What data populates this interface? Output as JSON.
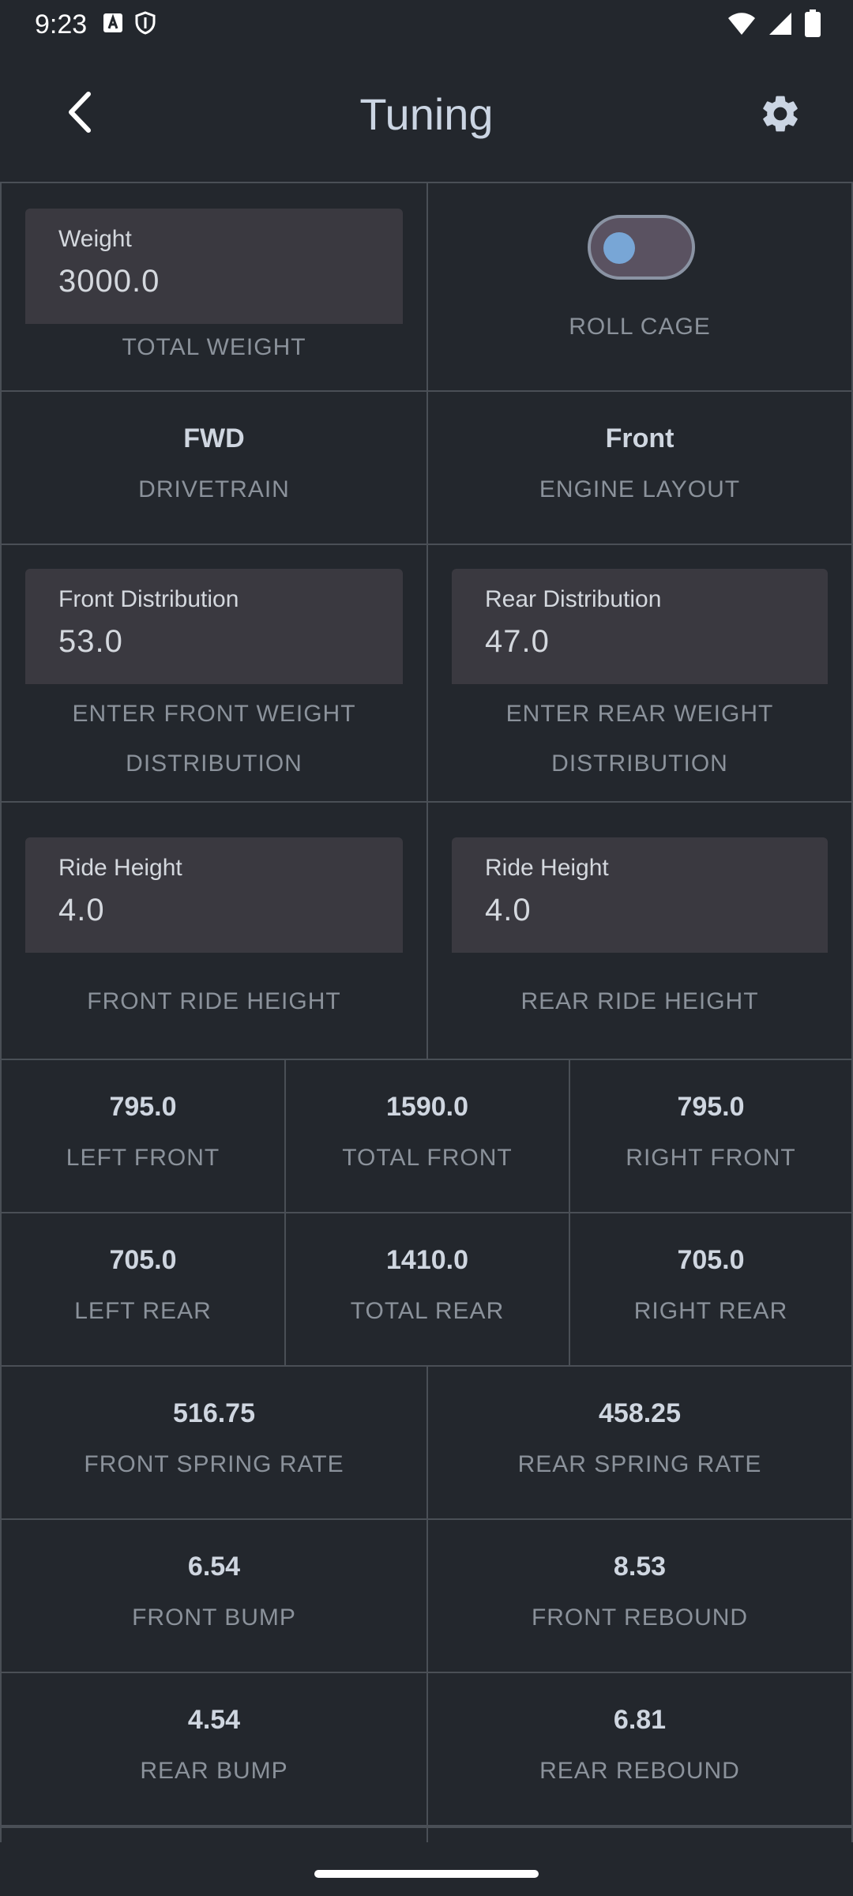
{
  "status_bar": {
    "time": "9:23"
  },
  "app_bar": {
    "title": "Tuning"
  },
  "weight_field": {
    "label": "Weight",
    "value": "3000.0",
    "caption": "TOTAL WEIGHT"
  },
  "roll_cage": {
    "caption": "ROLL CAGE",
    "enabled": false
  },
  "drivetrain": {
    "value": "FWD",
    "caption": "DRIVETRAIN"
  },
  "engine_layout": {
    "value": "Front",
    "caption": "ENGINE LAYOUT"
  },
  "front_distribution": {
    "label": "Front Distribution",
    "value": "53.0",
    "caption_line1": "ENTER FRONT WEIGHT",
    "caption_line2": "DISTRIBUTION"
  },
  "rear_distribution": {
    "label": "Rear Distribution",
    "value": "47.0",
    "caption_line1": "ENTER REAR WEIGHT",
    "caption_line2": "DISTRIBUTION"
  },
  "front_ride_height": {
    "label": "Ride Height",
    "value": "4.0",
    "caption": "FRONT RIDE HEIGHT"
  },
  "rear_ride_height": {
    "label": "Ride Height",
    "value": "4.0",
    "caption": "REAR RIDE HEIGHT"
  },
  "front_weights": [
    {
      "value": "795.0",
      "caption": "LEFT FRONT"
    },
    {
      "value": "1590.0",
      "caption": "TOTAL FRONT"
    },
    {
      "value": "795.0",
      "caption": "RIGHT FRONT"
    }
  ],
  "rear_weights": [
    {
      "value": "705.0",
      "caption": "LEFT REAR"
    },
    {
      "value": "1410.0",
      "caption": "TOTAL REAR"
    },
    {
      "value": "705.0",
      "caption": "RIGHT REAR"
    }
  ],
  "spring_rates": [
    {
      "value": "516.75",
      "caption": "FRONT SPRING RATE"
    },
    {
      "value": "458.25",
      "caption": "REAR SPRING RATE"
    }
  ],
  "front_damping": [
    {
      "value": "6.54",
      "caption": "FRONT BUMP"
    },
    {
      "value": "8.53",
      "caption": "FRONT REBOUND"
    }
  ],
  "rear_damping": [
    {
      "value": "4.54",
      "caption": "REAR BUMP"
    },
    {
      "value": "6.81",
      "caption": "REAR REBOUND"
    }
  ],
  "colors": {
    "background": "#23272d",
    "field_bg": "#3a3940",
    "divider": "#4a4f56",
    "title": "#cbd5e3",
    "caption": "#8b929b",
    "accent": "#78a6d6"
  }
}
